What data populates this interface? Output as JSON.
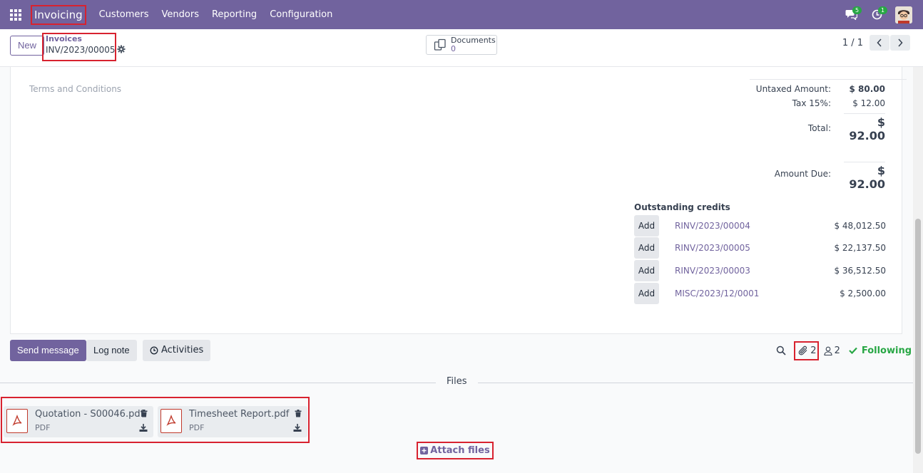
{
  "topbar": {
    "app_name": "Invoicing",
    "nav": [
      "Customers",
      "Vendors",
      "Reporting",
      "Configuration"
    ],
    "messages_badge": "5",
    "activities_badge": "1"
  },
  "control": {
    "new_label": "New",
    "breadcrumb_parent": "Invoices",
    "breadcrumb_current": "INV/2023/00005",
    "documents_label": "Documents",
    "documents_count": "0",
    "pager_value": "1 / 1"
  },
  "form": {
    "terms_placeholder": "Terms and Conditions",
    "untaxed_label": "Untaxed Amount:",
    "untaxed_value": "$ 80.00",
    "tax_label": "Tax 15%:",
    "tax_value": "$ 12.00",
    "total_label": "Total:",
    "total_value": "$ 92.00",
    "amount_due_label": "Amount Due:",
    "amount_due_value": "$ 92.00",
    "credits_title": "Outstanding credits",
    "add_label": "Add",
    "credits": [
      {
        "ref": "RINV/2023/00004",
        "amount": "$ 48,012.50"
      },
      {
        "ref": "RINV/2023/00005",
        "amount": "$ 22,137.50"
      },
      {
        "ref": "RINV/2023/00003",
        "amount": "$ 36,512.50"
      },
      {
        "ref": "MISC/2023/12/0001",
        "amount": "$ 2,500.00"
      }
    ]
  },
  "chatter": {
    "send_message": "Send message",
    "log_note": "Log note",
    "activities": "Activities",
    "attachments_count": "2",
    "followers_count": "2",
    "following": "Following",
    "files_title": "Files",
    "files": [
      {
        "name": "Quotation - S00046.pdf",
        "type": "PDF"
      },
      {
        "name": "Timesheet Report.pdf",
        "type": "PDF"
      }
    ],
    "attach_files": "Attach files"
  },
  "colors": {
    "brand": "#71639e",
    "highlight": "#d8222f",
    "success": "#28a745"
  }
}
